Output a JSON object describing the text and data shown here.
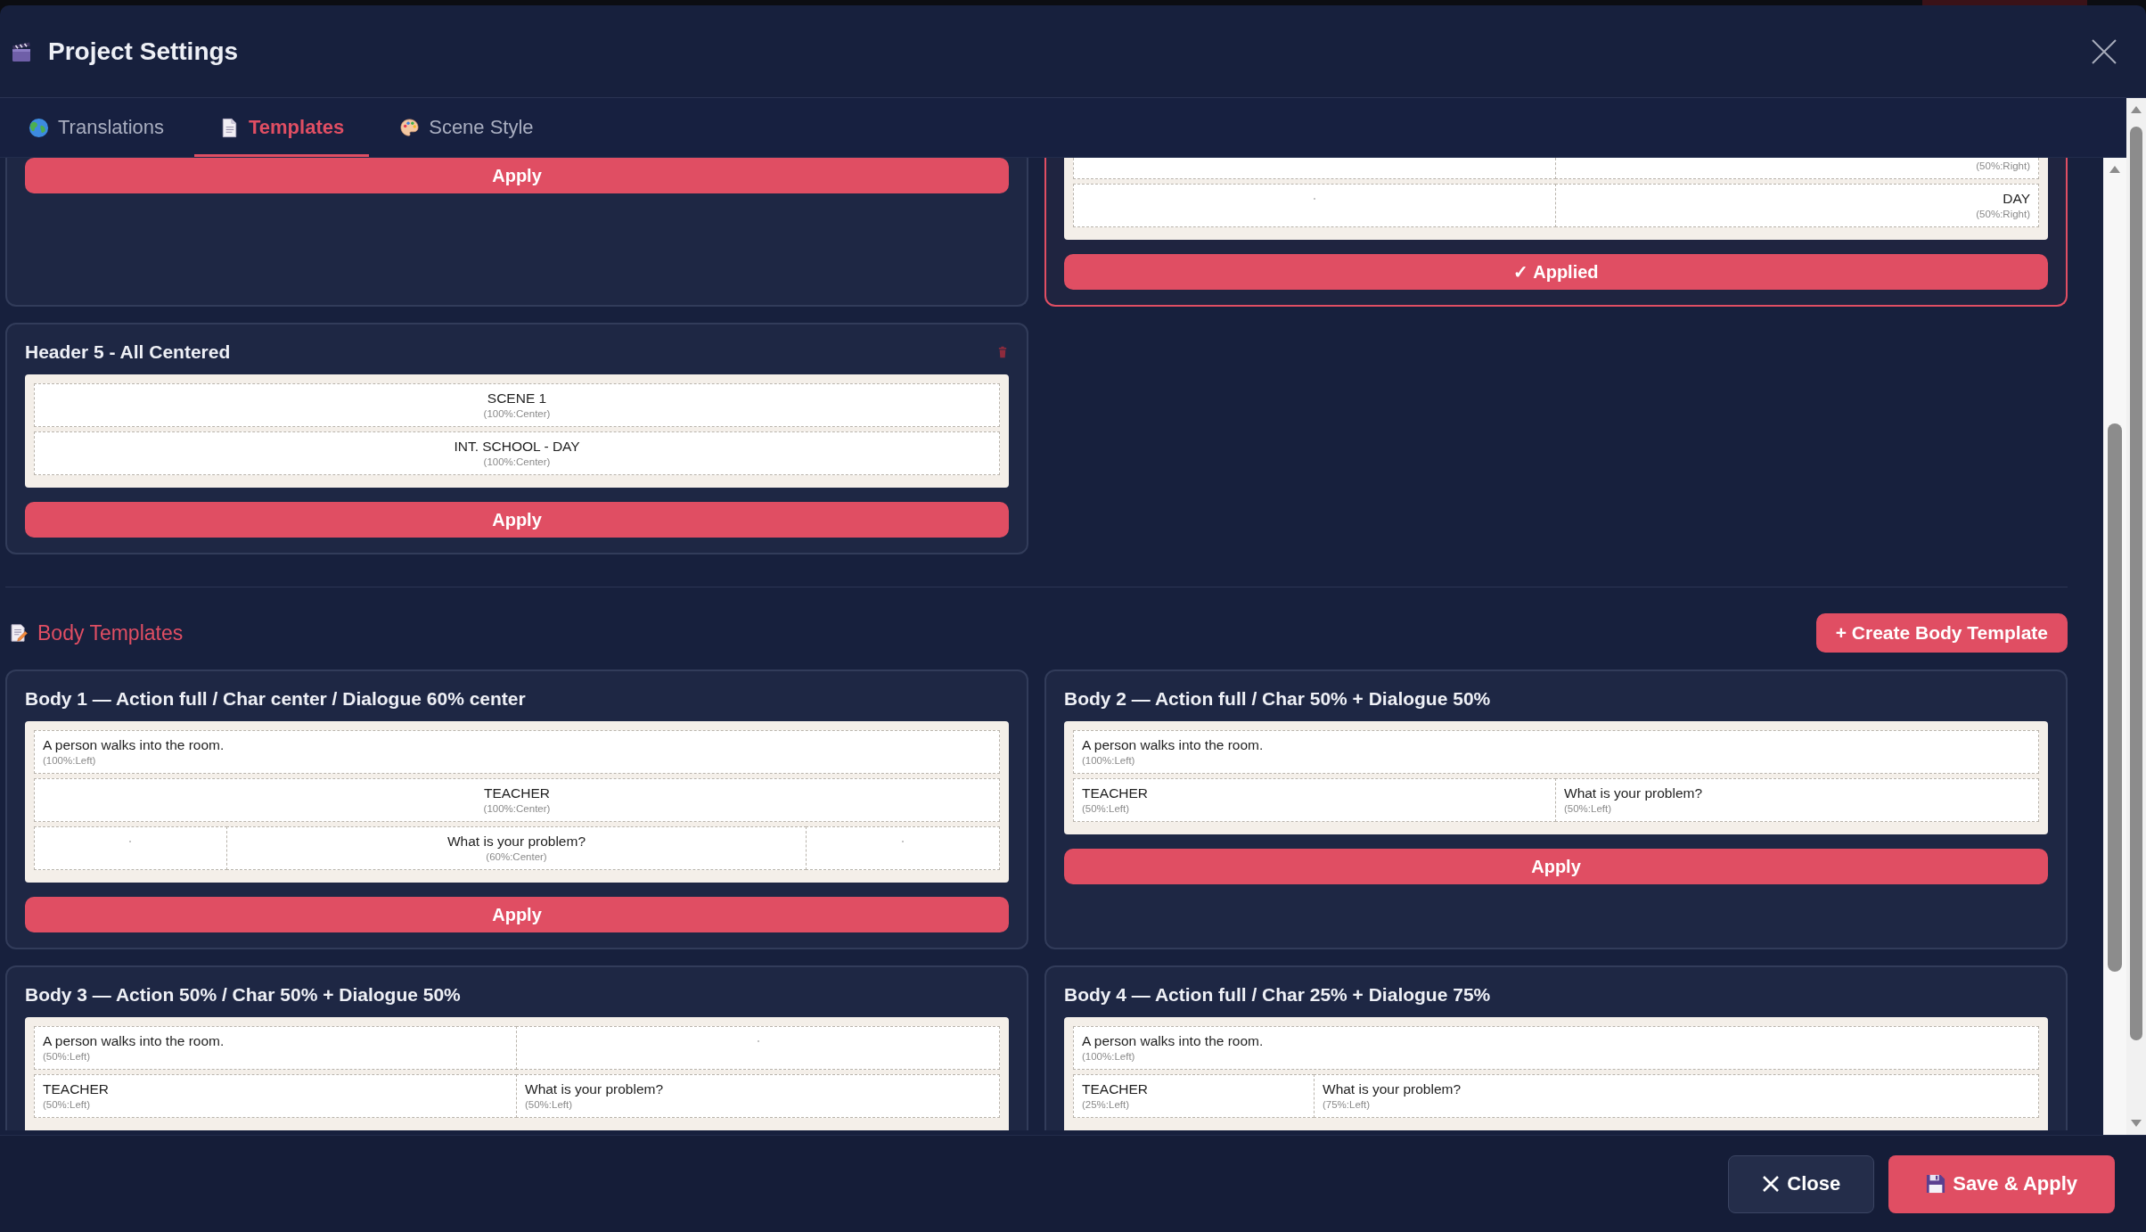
{
  "window": {
    "title": "Project Settings"
  },
  "tabs": [
    {
      "label": "Translations",
      "selected": false
    },
    {
      "label": "Templates",
      "selected": true
    },
    {
      "label": "Scene Style",
      "selected": false
    }
  ],
  "header_templates": [
    {
      "selected": false,
      "button": "Apply"
    },
    {
      "selected": true,
      "lines": [
        {
          "kind": "halves",
          "blocks": [
            {
              "kind": "blank"
            },
            {
              "kind": "right",
              "note": "(50%:Right)"
            }
          ]
        },
        {
          "kind": "halves",
          "blocks": [
            {
              "kind": "empty"
            },
            {
              "kind": "right",
              "text": "DAY",
              "note": "(50%:Right)"
            }
          ]
        }
      ],
      "button": "✓ Applied"
    },
    {
      "title": "Header 5 - All Centered",
      "deletable": true,
      "selected": false,
      "lines": [
        {
          "kind": "full",
          "blocks": [
            {
              "kind": "center",
              "text": "SCENE 1",
              "note": "(100%:Center)"
            }
          ]
        },
        {
          "kind": "full",
          "blocks": [
            {
              "kind": "center",
              "text": "INT. SCHOOL - DAY",
              "note": "(100%:Center)"
            }
          ]
        }
      ],
      "button": "Apply"
    }
  ],
  "body_section": {
    "title": "Body Templates",
    "create_button": "+ Create Body Template"
  },
  "body_templates": [
    {
      "title": "Body 1 — Action full / Char center / Dialogue 60% center",
      "selected": false,
      "lines": [
        {
          "kind": "full",
          "blocks": [
            {
              "kind": "left",
              "text": "A person walks into the room.",
              "note": "(100%:Left)"
            }
          ]
        },
        {
          "kind": "full",
          "blocks": [
            {
              "kind": "center",
              "text": "TEACHER",
              "note": "(100%:Center)"
            }
          ]
        },
        {
          "kind": "centered",
          "blocks": [
            {
              "kind": "empty"
            },
            {
              "kind": "center",
              "text": "What is your problem?",
              "note": "(60%:Center)"
            },
            {
              "kind": "empty"
            }
          ]
        }
      ],
      "button": "Apply"
    },
    {
      "title": "Body 2 — Action full / Char 50% + Dialogue 50%",
      "selected": false,
      "lines": [
        {
          "kind": "full",
          "blocks": [
            {
              "kind": "left",
              "text": "A person walks into the room.",
              "note": "(100%:Left)"
            }
          ]
        },
        {
          "kind": "halves",
          "blocks": [
            {
              "kind": "left",
              "text": "TEACHER",
              "note": "(50%:Left)"
            },
            {
              "kind": "left",
              "text": "What is your problem?",
              "note": "(50%:Left)"
            }
          ]
        }
      ],
      "button": "Apply"
    },
    {
      "title": "Body 3 — Action 50% / Char 50% + Dialogue 50%",
      "selected": false,
      "lines": [
        {
          "kind": "halves",
          "blocks": [
            {
              "kind": "left",
              "text": "A person walks into the room.",
              "note": "(50%:Left)"
            },
            {
              "kind": "empty"
            }
          ]
        },
        {
          "kind": "halves",
          "blocks": [
            {
              "kind": "left",
              "text": "TEACHER",
              "note": "(50%:Left)"
            },
            {
              "kind": "left",
              "text": "What is your problem?",
              "note": "(50%:Left)"
            }
          ]
        }
      ]
    },
    {
      "title": "Body 4 — Action full / Char 25% + Dialogue 75%",
      "selected": false,
      "lines": [
        {
          "kind": "full",
          "blocks": [
            {
              "kind": "left",
              "text": "A person walks into the room.",
              "note": "(100%:Left)"
            }
          ]
        },
        {
          "kind": "quarter",
          "blocks": [
            {
              "kind": "left",
              "text": "TEACHER",
              "note": "(25%:Left)"
            },
            {
              "kind": "left",
              "text": "What is your problem?",
              "note": "(75%:Left)"
            }
          ]
        }
      ]
    }
  ],
  "footer": {
    "buttons": [
      {
        "kind": "secondary",
        "label": "Close"
      },
      {
        "kind": "primary",
        "label": "Save & Apply"
      }
    ]
  }
}
